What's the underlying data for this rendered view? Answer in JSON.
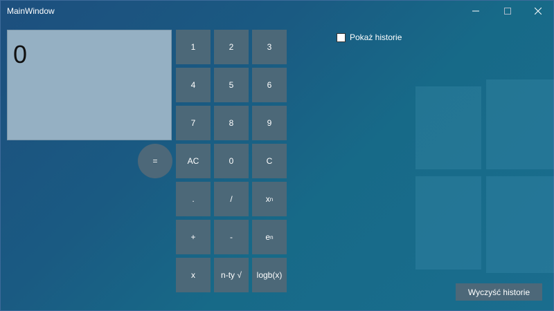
{
  "window": {
    "title": "MainWindow",
    "controls": [
      "minimize-icon",
      "maximize-icon",
      "close-icon"
    ]
  },
  "display": {
    "value": "0"
  },
  "keys": {
    "k1": "1",
    "k2": "2",
    "k3": "3",
    "k4": "4",
    "k5": "5",
    "k6": "6",
    "k7": "7",
    "k8": "8",
    "k9": "9",
    "ac": "AC",
    "k0": "0",
    "c": "C",
    "dot": ".",
    "divide": "/",
    "power_base": "x",
    "power_exp": "n",
    "plus": "+",
    "minus": "-",
    "exp_base": "e",
    "exp_exp": "n",
    "multiply": "x",
    "nth_root": "n-ty √",
    "log": "logb(x)",
    "equals": "="
  },
  "history": {
    "show_label": "Pokaż historie",
    "show_checked": false,
    "clear_label": "Wyczyść historie"
  }
}
